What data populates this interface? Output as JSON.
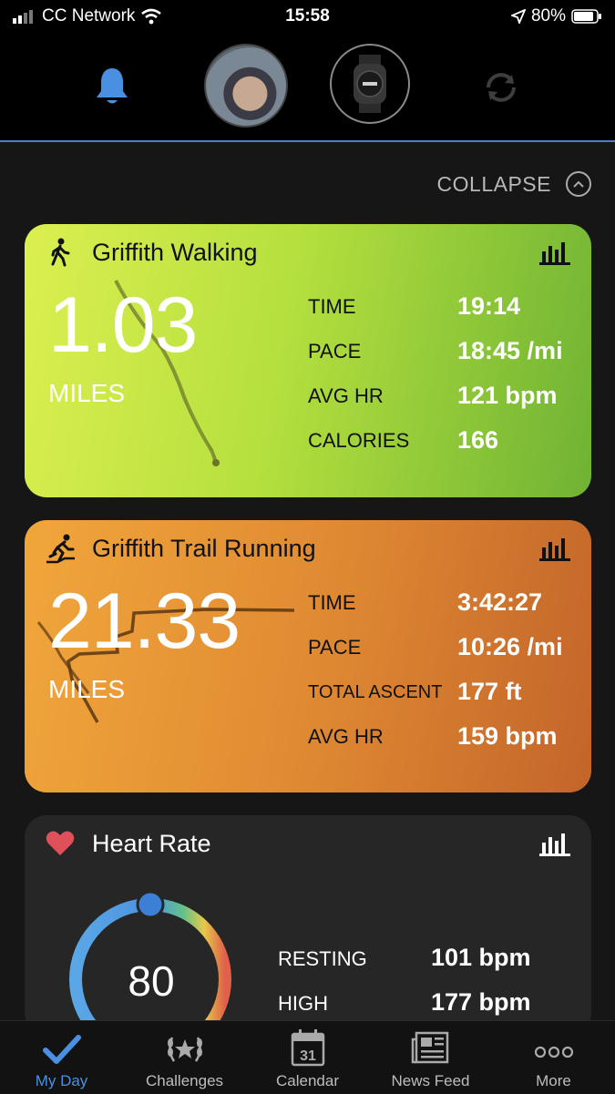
{
  "status_bar": {
    "carrier": "CC Network",
    "time": "15:58",
    "battery": "80%"
  },
  "header": {
    "icons": [
      "bell-icon",
      "profile-avatar",
      "watch-icon",
      "sync-icon"
    ]
  },
  "collapse_label": "COLLAPSE",
  "cards": [
    {
      "title": "Griffith Walking",
      "distance": "1.03",
      "unit": "MILES",
      "stats": [
        {
          "label": "TIME",
          "value": "19:14"
        },
        {
          "label": "PACE",
          "value": "18:45 /mi"
        },
        {
          "label": "AVG HR",
          "value": "121 bpm"
        },
        {
          "label": "CALORIES",
          "value": "166"
        }
      ]
    },
    {
      "title": "Griffith Trail Running",
      "distance": "21.33",
      "unit": "MILES",
      "stats": [
        {
          "label": "TIME",
          "value": "3:42:27"
        },
        {
          "label": "PACE",
          "value": "10:26 /mi"
        },
        {
          "label": "TOTAL ASCENT",
          "value": "177 ft"
        },
        {
          "label": "AVG HR",
          "value": "159 bpm"
        }
      ]
    }
  ],
  "heart_rate": {
    "title": "Heart Rate",
    "current": "80",
    "stats": [
      {
        "label": "RESTING",
        "value": "101 bpm"
      },
      {
        "label": "HIGH",
        "value": "177 bpm"
      }
    ]
  },
  "tabs": [
    {
      "label": "My Day",
      "icon": "check-icon",
      "active": true
    },
    {
      "label": "Challenges",
      "icon": "laurel-icon",
      "active": false
    },
    {
      "label": "Calendar",
      "icon": "calendar-icon",
      "calendar_day": "31",
      "active": false
    },
    {
      "label": "News Feed",
      "icon": "newspaper-icon",
      "active": false
    },
    {
      "label": "More",
      "icon": "more-dots-icon",
      "active": false
    }
  ],
  "colors": {
    "accent": "#4a90e2",
    "walk_card": "#b5e03e",
    "run_card": "#e08b33",
    "background": "#161616"
  }
}
